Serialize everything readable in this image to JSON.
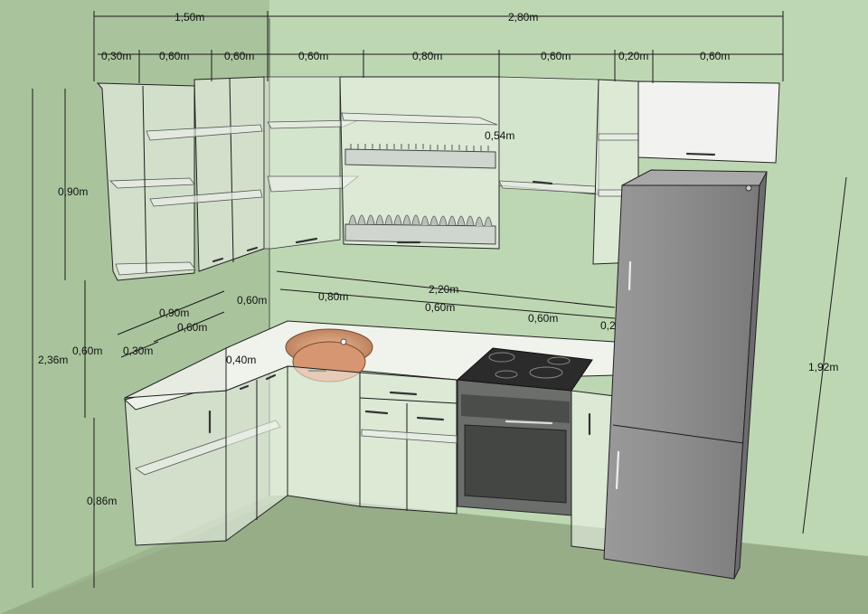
{
  "diagram": {
    "description_labels": {
      "total_left": "1,50m",
      "total_right": "2,80m",
      "top_row": [
        "0,30m",
        "0,60m",
        "0,60m",
        "0,60m",
        "0,80m",
        "0,60m",
        "0,20m",
        "0,60m"
      ],
      "upper_height": "0,90m",
      "rack_height": "0,54m",
      "total_height": "2,36m",
      "gap_height": "0,60m",
      "base_height": "0,86m",
      "fridge_height": "1,92m",
      "counter_width": "2,20m",
      "counter_row": [
        "0,80m",
        "0,60m",
        "0,60m",
        "0,2"
      ],
      "left_depth_a": "0,90m",
      "left_depth_b": "0,60m",
      "left_depth_c": "0,30m",
      "corner_a": "0,60m",
      "corner_b": "0,40m"
    },
    "colors": {
      "floor": "#9db58f",
      "wall": "#b9d4b0",
      "sky": "#7aa3c8",
      "fridge": "#8a8a8a",
      "sink": "#d9a07c",
      "hob": "#2b2b2b"
    }
  }
}
